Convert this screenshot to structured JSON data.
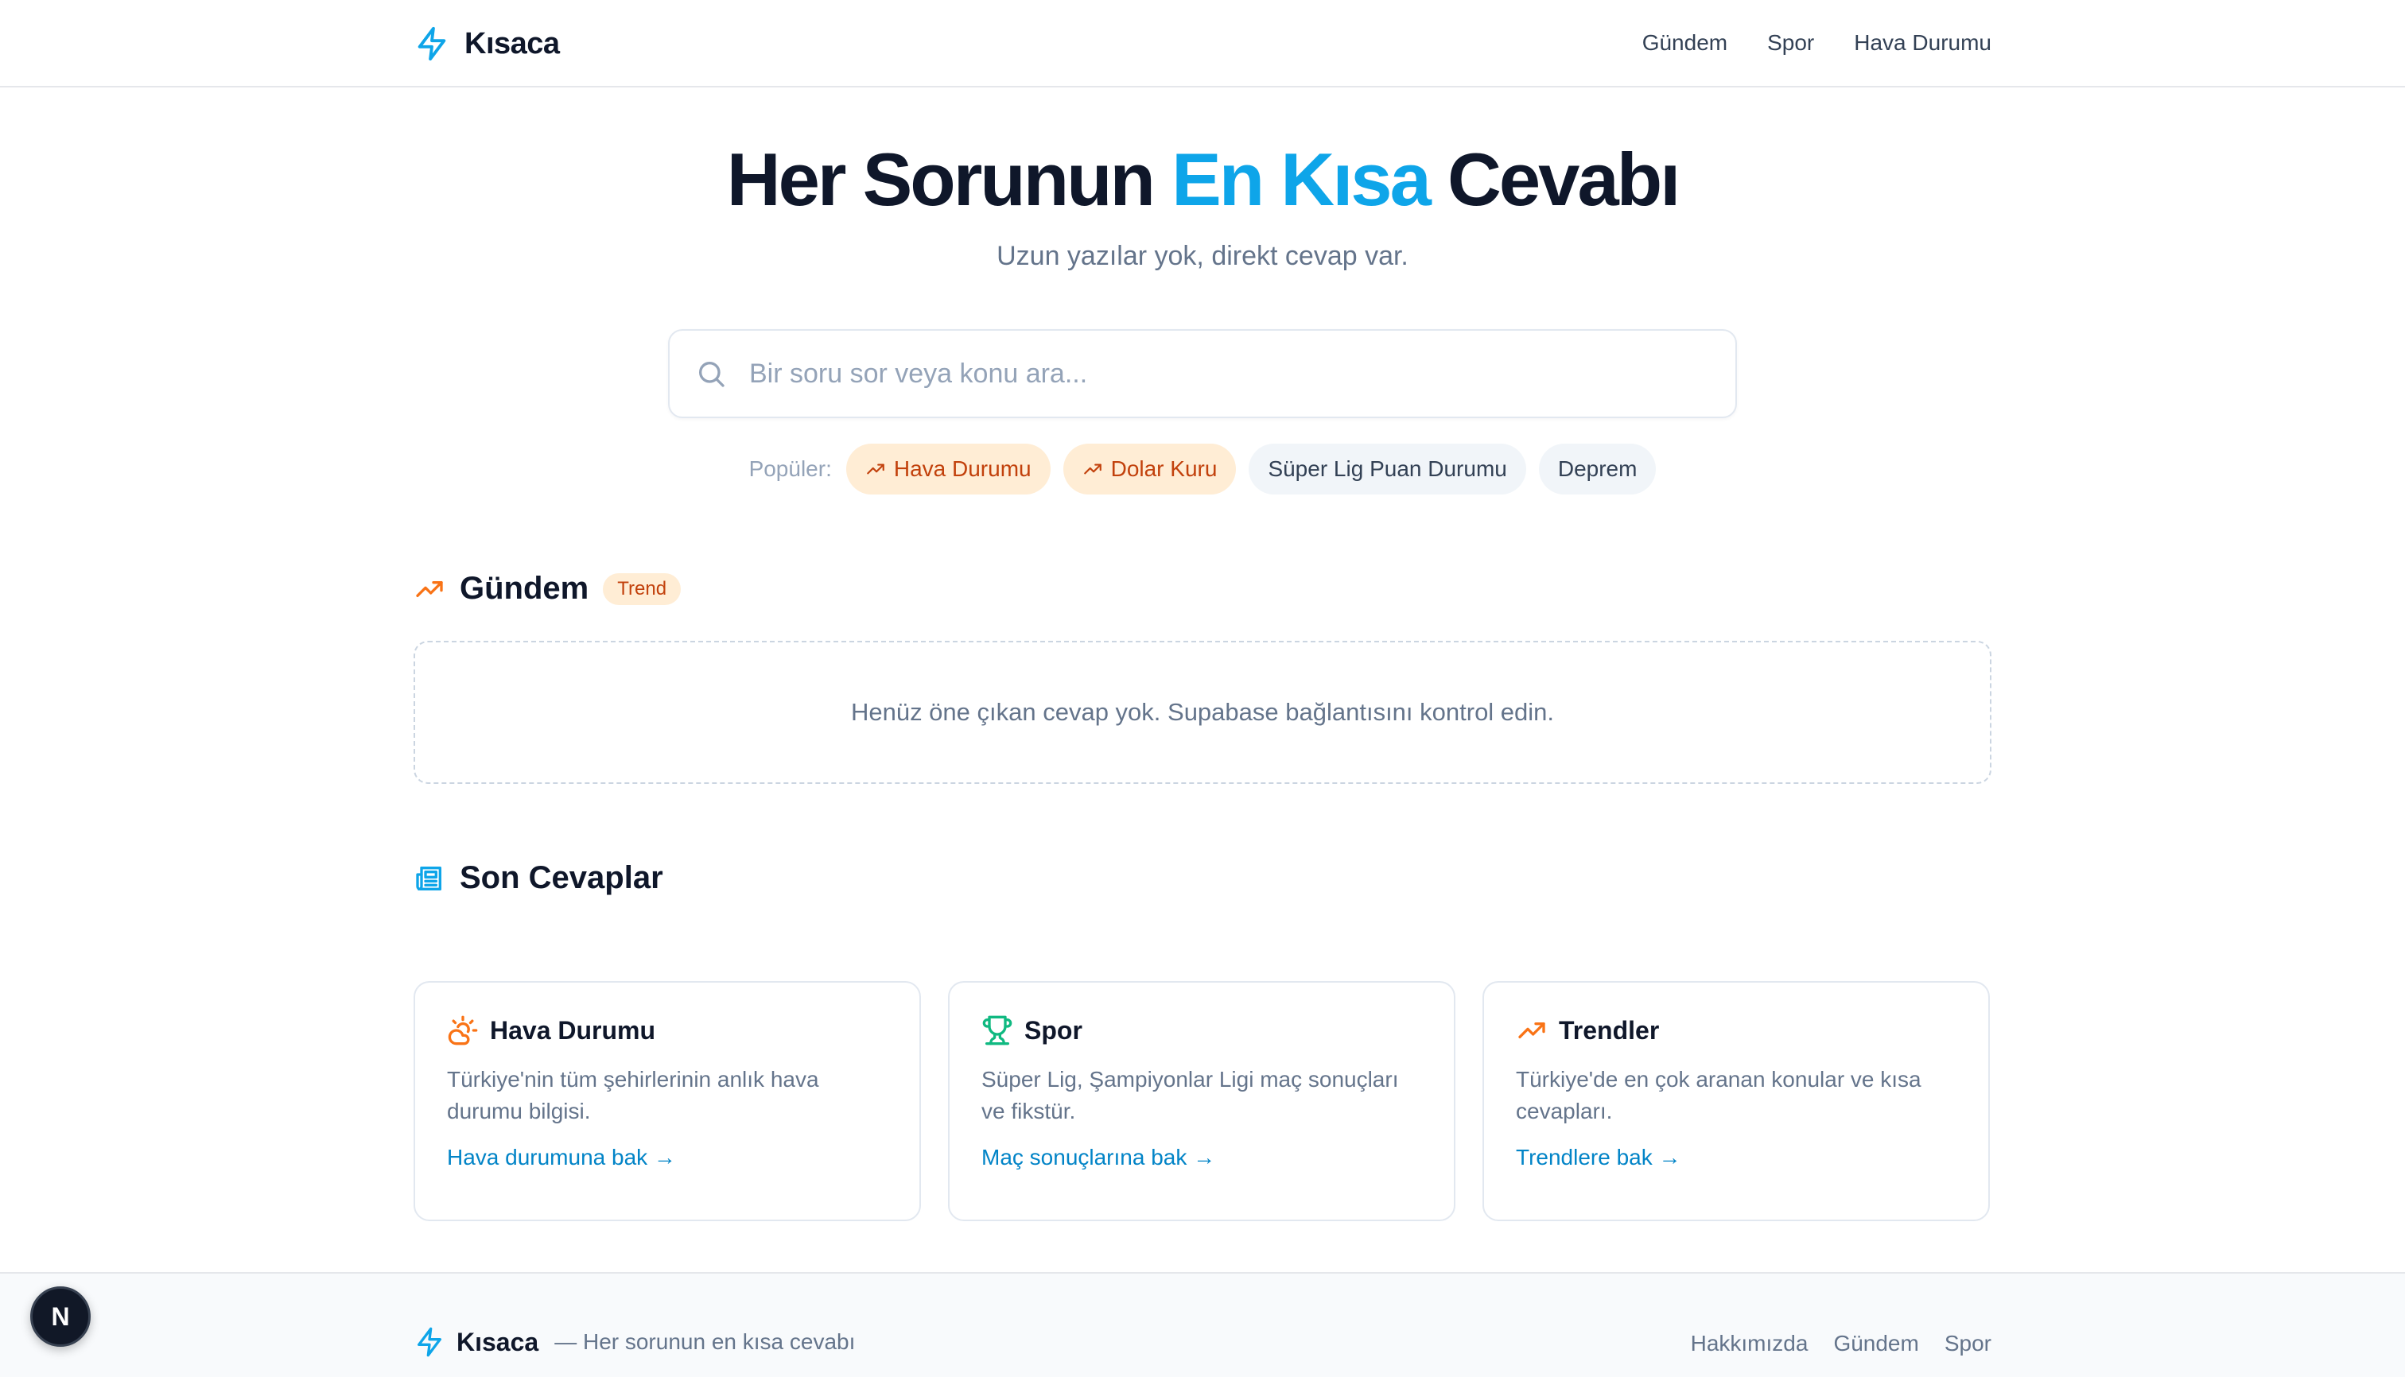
{
  "header": {
    "brand": "Kısaca",
    "nav": [
      "Gündem",
      "Spor",
      "Hava Durumu"
    ]
  },
  "hero": {
    "title_part1": "Her Sorunun",
    "title_accent": "En Kısa",
    "title_part2": "Cevabı",
    "subtitle": "Uzun yazılar yok, direkt cevap var."
  },
  "search": {
    "placeholder": "Bir soru sor veya konu ara...",
    "value": ""
  },
  "popular": {
    "label": "Popüler:",
    "chips": [
      {
        "label": "Hava Durumu",
        "trending": true
      },
      {
        "label": "Dolar Kuru",
        "trending": true
      },
      {
        "label": "Süper Lig Puan Durumu",
        "trending": false
      },
      {
        "label": "Deprem",
        "trending": false
      }
    ]
  },
  "gundem": {
    "title": "Gündem",
    "badge": "Trend",
    "empty_message": "Henüz öne çıkan cevap yok. Supabase bağlantısını kontrol edin."
  },
  "recent": {
    "title": "Son Cevaplar",
    "cards": [
      {
        "icon": "cloud-sun-icon",
        "title": "Hava Durumu",
        "description": "Türkiye'nin tüm şehirlerinin anlık hava durumu bilgisi.",
        "link": "Hava durumuna bak →"
      },
      {
        "icon": "trophy-icon",
        "title": "Spor",
        "description": "Süper Lig, Şampiyonlar Ligi maç sonuçları ve fikstür.",
        "link": "Maç sonuçlarına bak →"
      },
      {
        "icon": "trending-up-icon",
        "title": "Trendler",
        "description": "Türkiye'de en çok aranan konular ve kısa cevapları.",
        "link": "Trendlere bak →"
      }
    ]
  },
  "footer": {
    "brand": "Kısaca",
    "tagline": "— Her sorunun en kısa cevabı",
    "links": [
      "Hakkımızda",
      "Gündem",
      "Spor"
    ]
  },
  "dev_badge": "N",
  "colors": {
    "accent": "#0ea5e9",
    "trend": "#f97316",
    "sport": "#10b981",
    "text": "#0f172a",
    "muted": "#64748b"
  }
}
